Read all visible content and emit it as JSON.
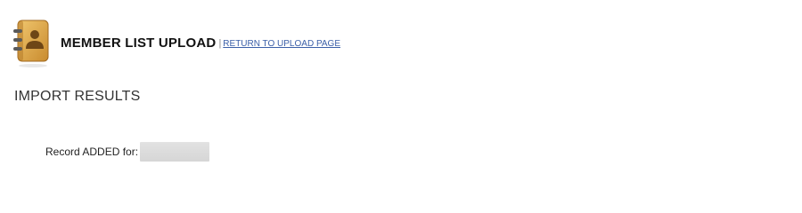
{
  "header": {
    "icon": "address-book-icon",
    "title": "MEMBER LIST UPLOAD",
    "separator": "|",
    "return_link": "RETURN TO UPLOAD PAGE"
  },
  "section": {
    "title": "IMPORT RESULTS"
  },
  "results": [
    {
      "label": "Record ADDED for:",
      "value_redacted": true
    }
  ],
  "colors": {
    "link": "#3b5fa8",
    "icon_body": "#d8a54a",
    "icon_dark": "#8a5a1c",
    "redaction": "#dcdcdc"
  }
}
